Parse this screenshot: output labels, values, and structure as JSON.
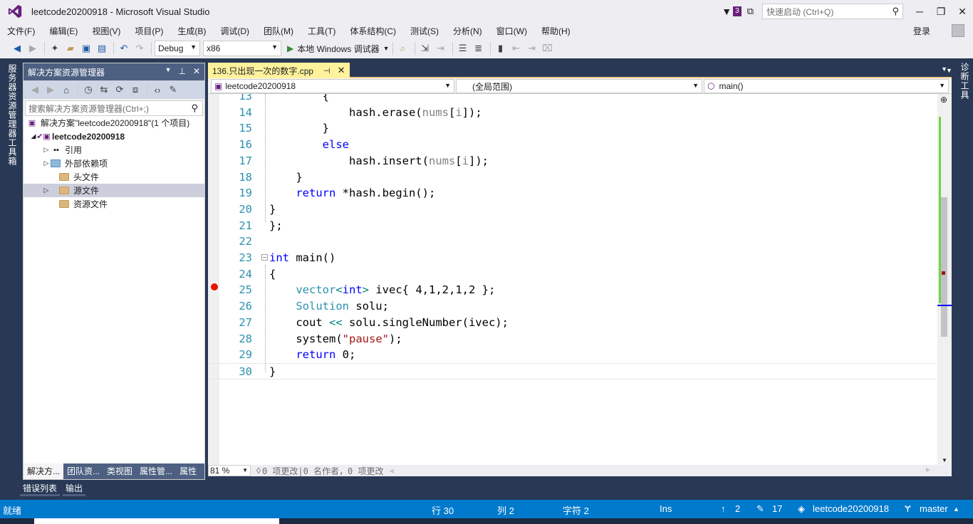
{
  "app": {
    "title": "leetcode20200918 - Microsoft Visual Studio",
    "notification_count": "3",
    "quick_launch_placeholder": "快速启动 (Ctrl+Q)",
    "login": "登录"
  },
  "menu": [
    "文件(F)",
    "编辑(E)",
    "视图(V)",
    "项目(P)",
    "生成(B)",
    "调试(D)",
    "团队(M)",
    "工具(T)",
    "体系结构(C)",
    "测试(S)",
    "分析(N)",
    "窗口(W)",
    "帮助(H)"
  ],
  "toolbar": {
    "config": "Debug",
    "platform": "x86",
    "run_label": "本地 Windows 调试器"
  },
  "left_strip": [
    "服务器资源管理器",
    "工具箱"
  ],
  "right_strip": [
    "诊断工具"
  ],
  "solution_explorer": {
    "title": "解决方案资源管理器",
    "search_placeholder": "搜索解决方案资源管理器(Ctrl+;)",
    "solution_label": "解决方案\"leetcode20200918\"(1 个项目)",
    "project_label": "leetcode20200918",
    "items": [
      "引用",
      "外部依赖项",
      "头文件",
      "源文件",
      "资源文件"
    ],
    "bottom_tabs": [
      "解决方...",
      "团队资...",
      "类视图",
      "属性管...",
      "属性"
    ]
  },
  "editor": {
    "tab_label": "136.只出现一次的数字.cpp",
    "nav_project": "leetcode20200918",
    "nav_scope": "(全局范围)",
    "nav_member": "main()",
    "zoom": "81 %",
    "codelens": "0 项更改|0 名作者，0 项更改",
    "lines": [
      {
        "n": "13",
        "text": "        {"
      },
      {
        "n": "14",
        "text": "            hash.erase(nums[i]);"
      },
      {
        "n": "15",
        "text": "        }"
      },
      {
        "n": "16",
        "text": "        else"
      },
      {
        "n": "17",
        "text": "            hash.insert(nums[i]);"
      },
      {
        "n": "18",
        "text": "    }"
      },
      {
        "n": "19",
        "text": "    return *hash.begin();"
      },
      {
        "n": "20",
        "text": "}"
      },
      {
        "n": "21",
        "text": "};"
      },
      {
        "n": "22",
        "text": ""
      },
      {
        "n": "23",
        "text": "int main()"
      },
      {
        "n": "24",
        "text": "{"
      },
      {
        "n": "25",
        "text": "    vector<int> ivec{ 4,1,2,1,2 };"
      },
      {
        "n": "26",
        "text": "    Solution solu;"
      },
      {
        "n": "27",
        "text": "    cout << solu.singleNumber(ivec);"
      },
      {
        "n": "28",
        "text": "    system(\"pause\");"
      },
      {
        "n": "29",
        "text": "    return 0;"
      },
      {
        "n": "30",
        "text": "}"
      }
    ]
  },
  "output_tabs": [
    "错误列表",
    "输出"
  ],
  "status": {
    "ready": "就绪",
    "line": "行 30",
    "col": "列 2",
    "char": "字符 2",
    "ins": "Ins",
    "up_count": "2",
    "edit_count": "17",
    "repo": "leetcode20200918",
    "branch": "master"
  },
  "colors": {
    "accent": "#007acc",
    "chrome": "#293955",
    "tab_active": "#fff29d",
    "keyword": "#0000ff",
    "type": "#2b91af",
    "breakpoint": "#e51400"
  }
}
